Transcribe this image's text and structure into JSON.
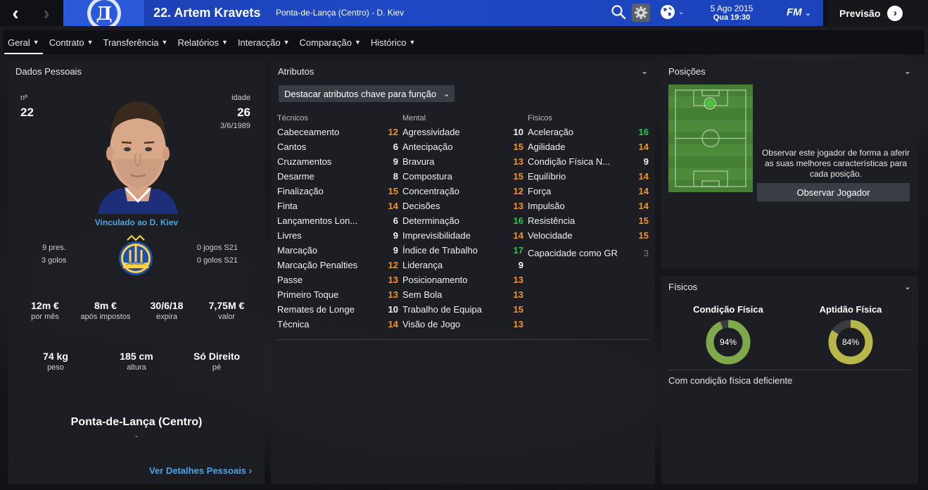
{
  "topbar": {
    "player_name": "22. Artem Kravets",
    "player_subtitle": "Ponta-de-Lança (Centro) - D. Kiev",
    "date": "5 Ago 2015",
    "time": "Qua 19:30",
    "fm_label": "FM",
    "preview_label": "Previsão",
    "club_color": "#1e48c4"
  },
  "tabs": [
    {
      "label": "Geral",
      "active": true
    },
    {
      "label": "Contrato"
    },
    {
      "label": "Transferência"
    },
    {
      "label": "Relatórios"
    },
    {
      "label": "Interacção"
    },
    {
      "label": "Comparação"
    },
    {
      "label": "Histórico"
    }
  ],
  "personal": {
    "title": "Dados Pessoais",
    "number_label": "nº",
    "number": "22",
    "age_label": "idade",
    "age": "26",
    "dob": "3/6/1989",
    "linked": "Vinculado ao D. Kiev",
    "caps": "9 pres.",
    "goals": "3 golos",
    "u21_caps": "0 jogos S21",
    "u21_goals": "0 golos S21",
    "crest_text": "УКРАЇНА",
    "money": [
      {
        "value": "12m €",
        "label": "por mês"
      },
      {
        "value": "8m €",
        "label": "após impostos"
      },
      {
        "value": "30/6/18",
        "label": "expira"
      },
      {
        "value": "7,75M €",
        "label": "valor"
      }
    ],
    "body": [
      {
        "value": "74 kg",
        "label": "peso"
      },
      {
        "value": "185 cm",
        "label": "altura"
      },
      {
        "value": "Só Direito",
        "label": "pé"
      }
    ],
    "position": "Ponta-de-Lança (Centro)",
    "position_sub": "-",
    "details_link": "Ver Detalhes Pessoais"
  },
  "attributes": {
    "title": "Atributos",
    "highlight_label": "Destacar atributos chave para função",
    "columns": [
      {
        "header": "Técnicos",
        "items": [
          {
            "name": "Cabeceamento",
            "value": "12",
            "color": "orange"
          },
          {
            "name": "Cantos",
            "value": "6",
            "color": "white"
          },
          {
            "name": "Cruzamentos",
            "value": "9",
            "color": "white"
          },
          {
            "name": "Desarme",
            "value": "8",
            "color": "white"
          },
          {
            "name": "Finalização",
            "value": "15",
            "color": "orange"
          },
          {
            "name": "Finta",
            "value": "14",
            "color": "orange"
          },
          {
            "name": "Lançamentos Lon...",
            "value": "6",
            "color": "white"
          },
          {
            "name": "Livres",
            "value": "9",
            "color": "white"
          },
          {
            "name": "Marcação",
            "value": "9",
            "color": "white"
          },
          {
            "name": "Marcação Penalties",
            "value": "12",
            "color": "orange"
          },
          {
            "name": "Passe",
            "value": "13",
            "color": "orange"
          },
          {
            "name": "Primeiro Toque",
            "value": "13",
            "color": "orange"
          },
          {
            "name": "Remates de Longe",
            "value": "10",
            "color": "white"
          },
          {
            "name": "Técnica",
            "value": "14",
            "color": "orange"
          }
        ]
      },
      {
        "header": "Mental",
        "items": [
          {
            "name": "Agressividade",
            "value": "10",
            "color": "white"
          },
          {
            "name": "Antecipação",
            "value": "15",
            "color": "orange"
          },
          {
            "name": "Bravura",
            "value": "13",
            "color": "orange"
          },
          {
            "name": "Compostura",
            "value": "15",
            "color": "orange"
          },
          {
            "name": "Concentração",
            "value": "12",
            "color": "orange"
          },
          {
            "name": "Decisões",
            "value": "13",
            "color": "orange"
          },
          {
            "name": "Determinação",
            "value": "16",
            "color": "green"
          },
          {
            "name": "Imprevisibilidade",
            "value": "14",
            "color": "orange"
          },
          {
            "name": "Índice de Trabalho",
            "value": "17",
            "color": "green"
          },
          {
            "name": "Liderança",
            "value": "9",
            "color": "white"
          },
          {
            "name": "Posicionamento",
            "value": "13",
            "color": "orange"
          },
          {
            "name": "Sem Bola",
            "value": "13",
            "color": "orange"
          },
          {
            "name": "Trabalho de Equipa",
            "value": "15",
            "color": "orange"
          },
          {
            "name": "Visão de Jogo",
            "value": "13",
            "color": "orange"
          }
        ]
      },
      {
        "header": "Físicos",
        "items": [
          {
            "name": "Aceleração",
            "value": "16",
            "color": "green"
          },
          {
            "name": "Agilidade",
            "value": "14",
            "color": "orange"
          },
          {
            "name": "Condição Física N...",
            "value": "9",
            "color": "white"
          },
          {
            "name": "Equilíbrio",
            "value": "14",
            "color": "orange"
          },
          {
            "name": "Força",
            "value": "14",
            "color": "orange"
          },
          {
            "name": "Impulsão",
            "value": "14",
            "color": "orange"
          },
          {
            "name": "Resistência",
            "value": "15",
            "color": "orange"
          },
          {
            "name": "Velocidade",
            "value": "15",
            "color": "orange"
          }
        ],
        "extra": {
          "name": "Capacidade como GR",
          "value": "3",
          "color": "grey"
        }
      }
    ]
  },
  "positions": {
    "title": "Posições",
    "observe_text": "Observar este jogador de forma a aferir as suas melhores características para cada posição.",
    "observe_button": "Observar Jogador"
  },
  "physical": {
    "title": "Físicos",
    "condition_label": "Condição Física",
    "condition_value": "94%",
    "condition_fraction": 0.94,
    "condition_color": "#7fa84a",
    "fitness_label": "Aptidão Física",
    "fitness_value": "84%",
    "fitness_fraction": 0.84,
    "fitness_color": "#b8b84a",
    "note": "Com condição física deficiente"
  }
}
